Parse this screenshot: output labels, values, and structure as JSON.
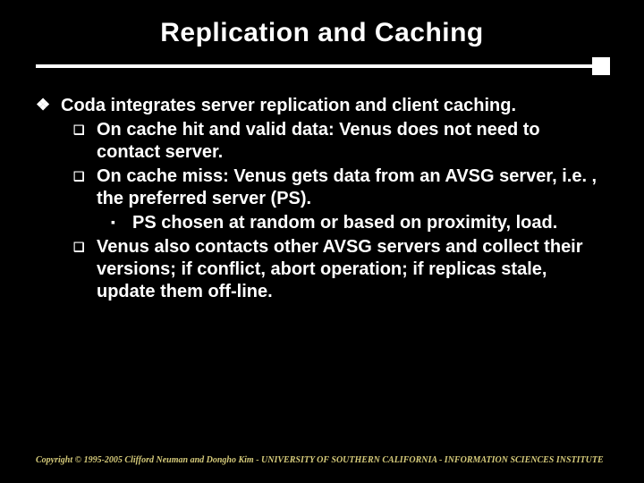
{
  "title": "Replication and Caching",
  "bullets": {
    "main": "Coda integrates server replication and client caching.",
    "sub1": "On cache hit and valid data: Venus does not need to contact server.",
    "sub2": "On cache miss: Venus gets data from an AVSG server, i.e. , the preferred server (PS).",
    "sub2a": "PS chosen at random or based on proximity, load.",
    "sub3": "Venus also contacts other AVSG servers and collect their versions; if conflict, abort operation; if replicas stale, update them off-line."
  },
  "footer": "Copyright © 1995-2005 Clifford Neuman and Dongho Kim - UNIVERSITY OF SOUTHERN CALIFORNIA - INFORMATION SCIENCES INSTITUTE"
}
